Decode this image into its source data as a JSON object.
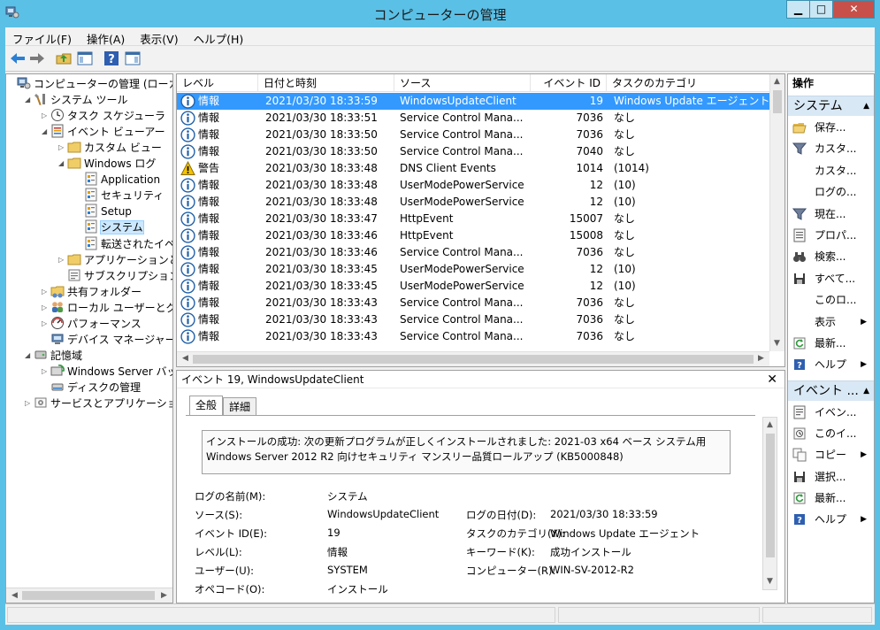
{
  "window": {
    "title": "コンピューターの管理",
    "btn_min": "▁",
    "btn_max": "□",
    "btn_close": "✕"
  },
  "menu": [
    "ファイル(F)",
    "操作(A)",
    "表示(V)",
    "ヘルプ(H)"
  ],
  "toolbar": [
    "back-arrow-icon",
    "forward-arrow-icon",
    "up-folder-icon",
    "show-tree-icon",
    "help-icon",
    "action-pane-icon"
  ],
  "tree": [
    {
      "label": "コンピューターの管理 (ローカル)",
      "level": 0,
      "toggle": "",
      "icon": "computer-management-icon"
    },
    {
      "label": "システム ツール",
      "level": 1,
      "toggle": "◢",
      "icon": "tools-icon"
    },
    {
      "label": "タスク スケジューラ",
      "level": 2,
      "toggle": "▷",
      "icon": "clock-icon"
    },
    {
      "label": "イベント ビューアー",
      "level": 2,
      "toggle": "◢",
      "icon": "event-viewer-icon"
    },
    {
      "label": "カスタム ビュー",
      "level": 3,
      "toggle": "▷",
      "icon": "folder-icon"
    },
    {
      "label": "Windows ログ",
      "level": 3,
      "toggle": "◢",
      "icon": "folder-icon"
    },
    {
      "label": "Application",
      "level": 4,
      "toggle": "",
      "icon": "log-icon"
    },
    {
      "label": "セキュリティ",
      "level": 4,
      "toggle": "",
      "icon": "log-icon"
    },
    {
      "label": "Setup",
      "level": 4,
      "toggle": "",
      "icon": "log-icon"
    },
    {
      "label": "システム",
      "level": 4,
      "toggle": "",
      "icon": "log-icon",
      "selected": true
    },
    {
      "label": "転送されたイベント",
      "level": 4,
      "toggle": "",
      "icon": "log-icon"
    },
    {
      "label": "アプリケーションとサービス",
      "level": 3,
      "toggle": "▷",
      "icon": "folder-icon"
    },
    {
      "label": "サブスクリプション",
      "level": 3,
      "toggle": "",
      "icon": "subscription-icon"
    },
    {
      "label": "共有フォルダー",
      "level": 2,
      "toggle": "▷",
      "icon": "shared-folder-icon"
    },
    {
      "label": "ローカル ユーザーとグループ",
      "level": 2,
      "toggle": "▷",
      "icon": "users-icon"
    },
    {
      "label": "パフォーマンス",
      "level": 2,
      "toggle": "▷",
      "icon": "performance-icon"
    },
    {
      "label": "デバイス マネージャー",
      "level": 2,
      "toggle": "",
      "icon": "device-manager-icon"
    },
    {
      "label": "記憶域",
      "level": 1,
      "toggle": "◢",
      "icon": "storage-icon"
    },
    {
      "label": "Windows Server バックアップ",
      "level": 2,
      "toggle": "▷",
      "icon": "backup-icon"
    },
    {
      "label": "ディスクの管理",
      "level": 2,
      "toggle": "",
      "icon": "disk-icon"
    },
    {
      "label": "サービスとアプリケーション",
      "level": 1,
      "toggle": "▷",
      "icon": "services-icon"
    }
  ],
  "list": {
    "columns": [
      "レベル",
      "日付と時刻",
      "ソース",
      "イベント ID",
      "タスクのカテゴリ"
    ],
    "rows": [
      {
        "level": "情報",
        "type": "info",
        "datetime": "2021/03/30 18:33:59",
        "source": "WindowsUpdateClient",
        "id": "19",
        "category": "Windows Update エージェント",
        "selected": true
      },
      {
        "level": "情報",
        "type": "info",
        "datetime": "2021/03/30 18:33:51",
        "source": "Service Control Mana...",
        "id": "7036",
        "category": "なし"
      },
      {
        "level": "情報",
        "type": "info",
        "datetime": "2021/03/30 18:33:50",
        "source": "Service Control Mana...",
        "id": "7036",
        "category": "なし"
      },
      {
        "level": "情報",
        "type": "info",
        "datetime": "2021/03/30 18:33:50",
        "source": "Service Control Mana...",
        "id": "7040",
        "category": "なし"
      },
      {
        "level": "警告",
        "type": "warn",
        "datetime": "2021/03/30 18:33:48",
        "source": "DNS Client Events",
        "id": "1014",
        "category": "(1014)"
      },
      {
        "level": "情報",
        "type": "info",
        "datetime": "2021/03/30 18:33:48",
        "source": "UserModePowerService",
        "id": "12",
        "category": "(10)"
      },
      {
        "level": "情報",
        "type": "info",
        "datetime": "2021/03/30 18:33:48",
        "source": "UserModePowerService",
        "id": "12",
        "category": "(10)"
      },
      {
        "level": "情報",
        "type": "info",
        "datetime": "2021/03/30 18:33:47",
        "source": "HttpEvent",
        "id": "15007",
        "category": "なし"
      },
      {
        "level": "情報",
        "type": "info",
        "datetime": "2021/03/30 18:33:46",
        "source": "HttpEvent",
        "id": "15008",
        "category": "なし"
      },
      {
        "level": "情報",
        "type": "info",
        "datetime": "2021/03/30 18:33:46",
        "source": "Service Control Mana...",
        "id": "7036",
        "category": "なし"
      },
      {
        "level": "情報",
        "type": "info",
        "datetime": "2021/03/30 18:33:45",
        "source": "UserModePowerService",
        "id": "12",
        "category": "(10)"
      },
      {
        "level": "情報",
        "type": "info",
        "datetime": "2021/03/30 18:33:45",
        "source": "UserModePowerService",
        "id": "12",
        "category": "(10)"
      },
      {
        "level": "情報",
        "type": "info",
        "datetime": "2021/03/30 18:33:43",
        "source": "Service Control Mana...",
        "id": "7036",
        "category": "なし"
      },
      {
        "level": "情報",
        "type": "info",
        "datetime": "2021/03/30 18:33:43",
        "source": "Service Control Mana...",
        "id": "7036",
        "category": "なし"
      },
      {
        "level": "情報",
        "type": "info",
        "datetime": "2021/03/30 18:33:43",
        "source": "Service Control Mana...",
        "id": "7036",
        "category": "なし"
      }
    ]
  },
  "detail": {
    "header": "イベント 19, WindowsUpdateClient",
    "close": "✕",
    "tabs": [
      "全般",
      "詳細"
    ],
    "description": "インストールの成功: 次の更新プログラムが正しくインストールされました: 2021-03 x64 ベース システム用 Windows Server 2012 R2 向けセキュリティ マンスリー品質ロールアップ (KB5000848)",
    "fields": {
      "log_name_label": "ログの名前(M):",
      "log_name": "システム",
      "source_label": "ソース(S):",
      "source": "WindowsUpdateClient",
      "logged_label": "ログの日付(D):",
      "logged": "2021/03/30 18:33:59",
      "event_id_label": "イベント ID(E):",
      "event_id": "19",
      "task_label": "タスクのカテゴリ(Y):",
      "task": "Windows Update エージェント",
      "level_label": "レベル(L):",
      "level": "情報",
      "keywords_label": "キーワード(K):",
      "keywords": "成功インストール",
      "user_label": "ユーザー(U):",
      "user": "SYSTEM",
      "computer_label": "コンピューター(R):",
      "computer": "WIN-SV-2012-R2",
      "opcode_label": "オペコード(O):",
      "opcode": "インストール"
    }
  },
  "actions": {
    "header": "操作",
    "section1": "システム",
    "items1": [
      {
        "label": "保存...",
        "icon": "open-folder-icon"
      },
      {
        "label": "カスタ...",
        "icon": "filter-icon"
      },
      {
        "label": "カスタ...",
        "icon": ""
      },
      {
        "label": "ログの...",
        "icon": ""
      },
      {
        "label": "現在...",
        "icon": "filter-icon"
      },
      {
        "label": "プロパ...",
        "icon": "properties-icon"
      },
      {
        "label": "検索...",
        "icon": "binoculars-icon"
      },
      {
        "label": "すべて...",
        "icon": "save-icon"
      },
      {
        "label": "このロ...",
        "icon": ""
      },
      {
        "label": "表示",
        "icon": "",
        "sub": true
      },
      {
        "label": "最新...",
        "icon": "refresh-icon"
      },
      {
        "label": "ヘルプ",
        "icon": "help-icon",
        "sub": true
      }
    ],
    "section2": "イベント ...",
    "items2": [
      {
        "label": "イベン...",
        "icon": "event-properties-icon"
      },
      {
        "label": "このイ...",
        "icon": "attach-task-icon"
      },
      {
        "label": "コピー",
        "icon": "copy-icon",
        "sub": true
      },
      {
        "label": "選択...",
        "icon": "save-icon"
      },
      {
        "label": "最新...",
        "icon": "refresh-icon"
      },
      {
        "label": "ヘルプ",
        "icon": "help-icon",
        "sub": true
      }
    ]
  },
  "colors": {
    "titlebar": "#5bc0e6",
    "selection": "#3399ff",
    "section": "#d9e8f5"
  }
}
